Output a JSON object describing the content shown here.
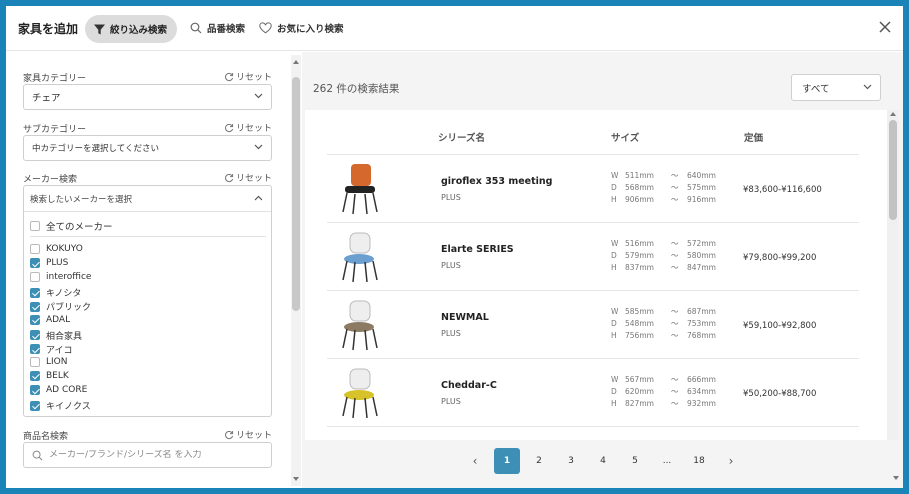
{
  "header": {
    "title": "家具を追加",
    "tabs": [
      {
        "label": "絞り込み検索",
        "icon": "filter-icon"
      },
      {
        "label": "品番検索",
        "icon": "search-icon"
      },
      {
        "label": "お気に入り検索",
        "icon": "heart-icon"
      }
    ]
  },
  "sidebar": {
    "reset_label": "リセット",
    "category": {
      "label": "家具カテゴリー",
      "value": "チェア"
    },
    "subcategory": {
      "label": "サブカテゴリー",
      "value": "中カテゴリーを選択してください"
    },
    "maker": {
      "label": "メーカー検索",
      "placeholder": "検索したいメーカーを選択",
      "all_label": "全てのメーカー",
      "items": [
        {
          "label": "KOKUYO",
          "checked": false
        },
        {
          "label": "PLUS",
          "checked": true
        },
        {
          "label": "interoffice",
          "checked": false
        },
        {
          "label": "キノシタ",
          "checked": true
        },
        {
          "label": "パブリック",
          "checked": true
        },
        {
          "label": "ADAL",
          "checked": true
        },
        {
          "label": "相合家具",
          "checked": true
        },
        {
          "label": "アイコ",
          "checked": true
        },
        {
          "label": "LION",
          "checked": false
        },
        {
          "label": "BELK",
          "checked": true
        },
        {
          "label": "AD CORE",
          "checked": true
        },
        {
          "label": "キイノクス",
          "checked": true
        }
      ]
    },
    "product_search": {
      "label": "商品名検索",
      "placeholder": "メーカー/ブランド/シリーズ名 を入力"
    }
  },
  "main": {
    "result_count": "262 件の検索結果",
    "sort": {
      "value": "すべて"
    },
    "columns": {
      "series": "シリーズ名",
      "size": "サイズ",
      "price": "定価"
    },
    "dim_sep": "〜",
    "products": [
      {
        "name": "giroflex 353 meeting",
        "brand": "PLUS",
        "seat_color": "#d4682d",
        "dims": [
          {
            "k": "W",
            "min": "511mm",
            "max": "640mm"
          },
          {
            "k": "D",
            "min": "568mm",
            "max": "575mm"
          },
          {
            "k": "H",
            "min": "906mm",
            "max": "916mm"
          }
        ],
        "price": "¥83,600-¥116,600"
      },
      {
        "name": "Elarte SERIES",
        "brand": "PLUS",
        "seat_color": "#6a9fd0",
        "dims": [
          {
            "k": "W",
            "min": "516mm",
            "max": "572mm"
          },
          {
            "k": "D",
            "min": "579mm",
            "max": "580mm"
          },
          {
            "k": "H",
            "min": "837mm",
            "max": "847mm"
          }
        ],
        "price": "¥79,800-¥99,200"
      },
      {
        "name": "NEWMAL",
        "brand": "PLUS",
        "seat_color": "#8c7a62",
        "dims": [
          {
            "k": "W",
            "min": "585mm",
            "max": "687mm"
          },
          {
            "k": "D",
            "min": "548mm",
            "max": "753mm"
          },
          {
            "k": "H",
            "min": "756mm",
            "max": "768mm"
          }
        ],
        "price": "¥59,100-¥92,800"
      },
      {
        "name": "Cheddar-C",
        "brand": "PLUS",
        "seat_color": "#d8c22a",
        "dims": [
          {
            "k": "W",
            "min": "567mm",
            "max": "666mm"
          },
          {
            "k": "D",
            "min": "620mm",
            "max": "634mm"
          },
          {
            "k": "H",
            "min": "827mm",
            "max": "932mm"
          }
        ],
        "price": "¥50,200-¥88,700"
      }
    ],
    "pagination": {
      "prev": "‹",
      "next": "›",
      "pages": [
        "1",
        "2",
        "3",
        "4",
        "5",
        "...",
        "18"
      ],
      "active": "1"
    }
  }
}
